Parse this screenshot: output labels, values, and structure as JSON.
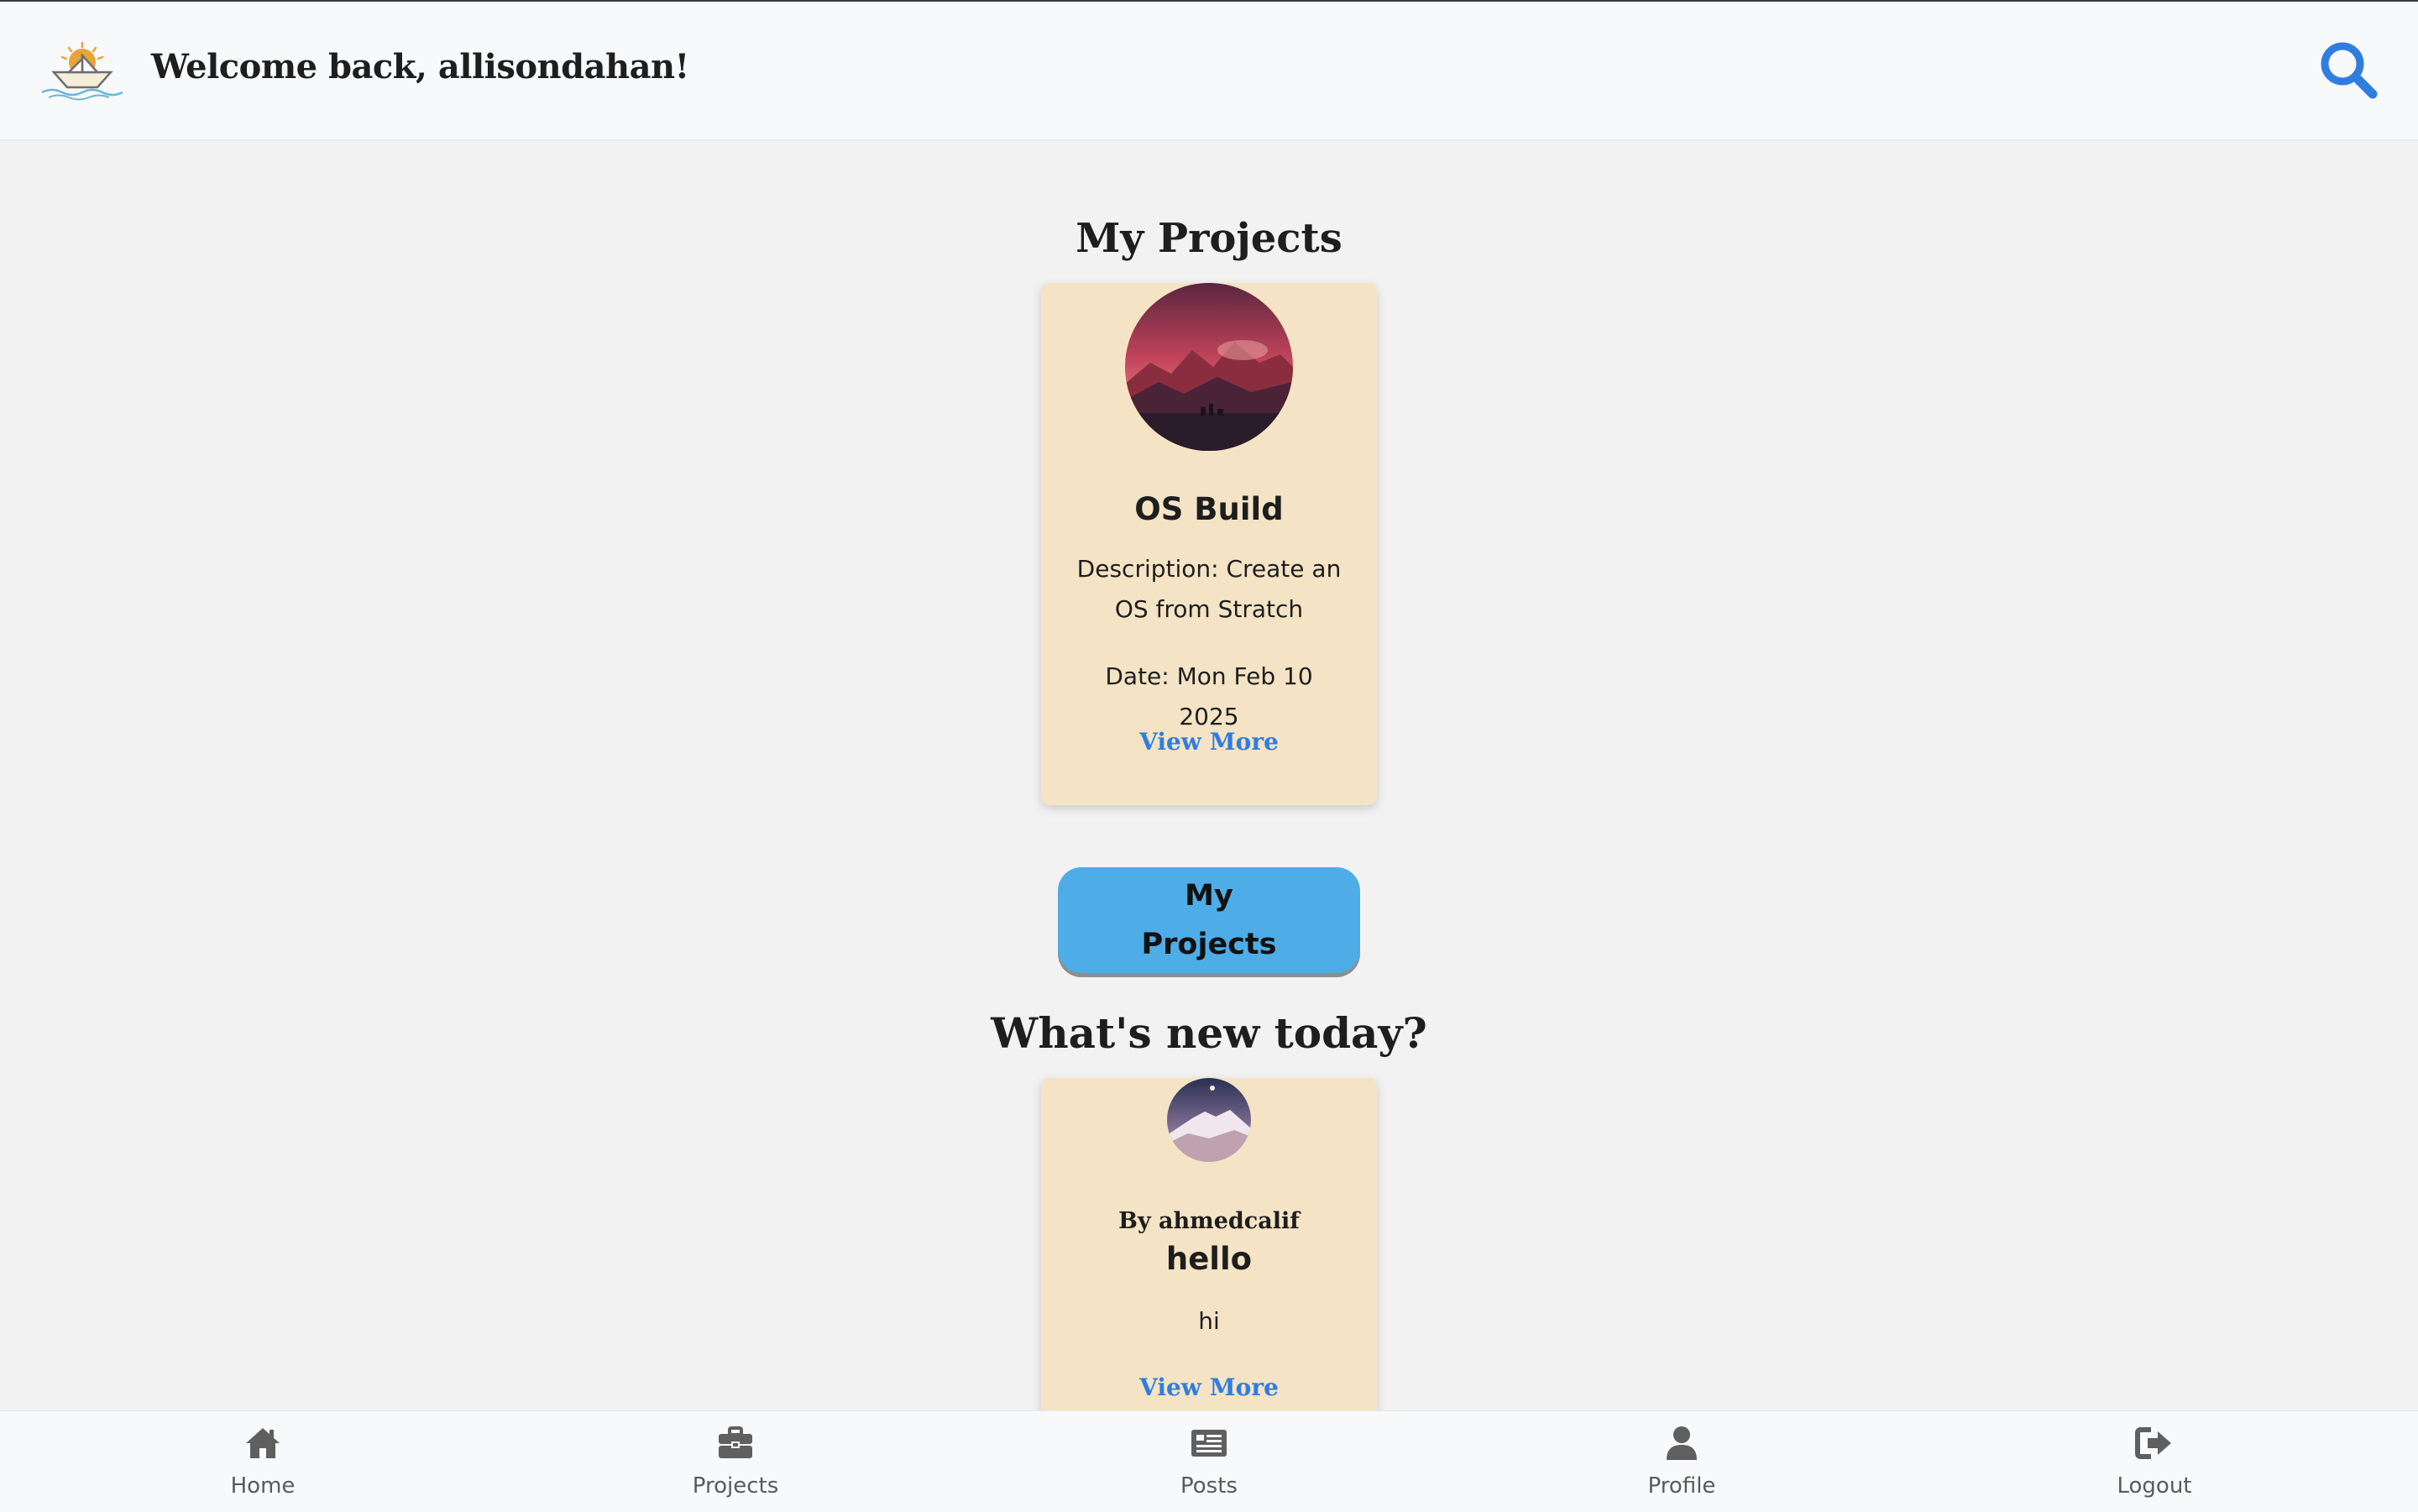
{
  "header": {
    "welcome": "Welcome back, allisondahan!",
    "logo_icon": "paper-boat-sunset-logo",
    "search_icon": "search-icon"
  },
  "projects_section": {
    "title": "My Projects",
    "projects": [
      {
        "name": "OS Build",
        "description": "Description: Create an OS from Stratch",
        "date": "Date: Mon Feb 10 2025",
        "link": "View More",
        "image": "red-mountain-sunset-image"
      }
    ],
    "button_label": "My Projects"
  },
  "posts_section": {
    "title": "What's new today?",
    "posts": [
      {
        "author": "By ahmedcalif",
        "title": "hello",
        "body": "hi",
        "link": "View More",
        "image": "night-mountain-image"
      }
    ]
  },
  "bottom_nav": {
    "items": [
      {
        "label": "Home",
        "icon": "home-icon"
      },
      {
        "label": "Projects",
        "icon": "briefcase-icon"
      },
      {
        "label": "Posts",
        "icon": "newspaper-icon"
      },
      {
        "label": "Profile",
        "icon": "user-icon"
      },
      {
        "label": "Logout",
        "icon": "logout-icon"
      }
    ]
  },
  "colors": {
    "accent": "#2f7de1",
    "card": "#f4e4c5",
    "button": "#4eade6",
    "background": "#f2f2f2"
  }
}
